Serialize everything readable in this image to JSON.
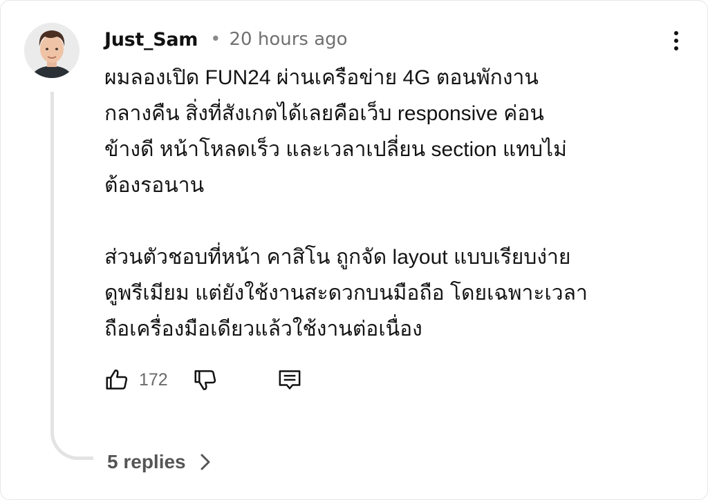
{
  "comment": {
    "author": "Just_Sam",
    "separator": "•",
    "time": "20 hours ago",
    "paragraphs": [
      "ผมลองเปิด FUN24 ผ่านเครือข่าย 4G ตอนพักงาน\nกลางคืน สิ่งที่สังเกตได้เลยคือเว็บ responsive ค่อน\nข้างดี หน้าโหลดเร็ว และเวลาเปลี่ยน section แทบไม่\nต้องรอนาน",
      "ส่วนตัวชอบที่หน้า คาสิโน ถูกจัด layout แบบเรียบง่าย\nดูพรีเมียม แต่ยังใช้งานสะดวกบนมือถือ โดยเฉพาะเวลา\nถือเครื่องมือเดียวแล้วใช้งานต่อเนื่อง"
    ],
    "likes": "172",
    "replies_label": "5 replies"
  },
  "icons": {
    "avatar": "avatar-photo",
    "menu": "more-vert-icon",
    "like": "thumbs-up-icon",
    "dislike": "thumbs-down-icon",
    "reply": "comment-icon",
    "chevron": "chevron-right-icon"
  },
  "colors": {
    "text": "#141414",
    "muted": "#707070",
    "thread_line": "#e3e3e3"
  }
}
